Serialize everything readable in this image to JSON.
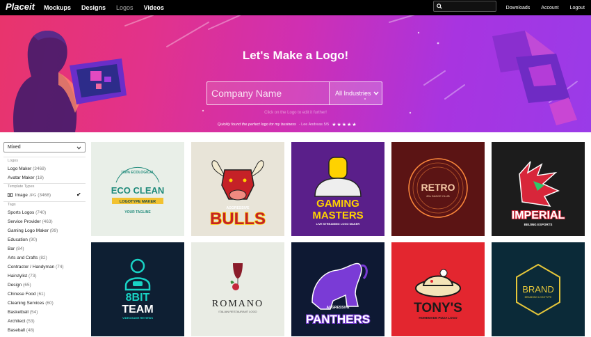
{
  "nav": {
    "brand": "Placeit",
    "links": [
      "Mockups",
      "Designs",
      "Logos",
      "Videos"
    ],
    "right": [
      "Downloads",
      "Account",
      "Logout"
    ],
    "search_placeholder": ""
  },
  "hero": {
    "title": "Let's Make a Logo!",
    "company_placeholder": "Company Name",
    "industry_selected": "All Industries",
    "hint": "Click on the Logo to edit it further!",
    "testimonial": "Quickly found the perfect logo for my business",
    "author": "- Lee Andreas 5/5",
    "stars": "★★★★★",
    "colors": {
      "start": "#e8346c",
      "mid": "#cf2fb3",
      "end": "#9a3be8"
    }
  },
  "sidebar": {
    "sort": "Mixed",
    "sections": {
      "logos": "Logos",
      "template_types": "Template Types",
      "tags": "Tags"
    },
    "logo_items": [
      {
        "label": "Logo Maker",
        "count": "(3468)"
      },
      {
        "label": "Avatar Maker",
        "count": "(18)"
      }
    ],
    "template_item": {
      "label": "Image",
      "format": "JPG",
      "count": "(3468)"
    },
    "tags": [
      {
        "label": "Sports Logos",
        "count": "(740)"
      },
      {
        "label": "Service Provider",
        "count": "(463)"
      },
      {
        "label": "Gaming Logo Maker",
        "count": "(99)"
      },
      {
        "label": "Education",
        "count": "(90)"
      },
      {
        "label": "Bar",
        "count": "(84)"
      },
      {
        "label": "Arts and Crafts",
        "count": "(82)"
      },
      {
        "label": "Contractor / Handyman",
        "count": "(74)"
      },
      {
        "label": "Hairstylist",
        "count": "(73)"
      },
      {
        "label": "Design",
        "count": "(65)"
      },
      {
        "label": "Chinese Food",
        "count": "(61)"
      },
      {
        "label": "Cleaning Services",
        "count": "(60)"
      },
      {
        "label": "Basketball",
        "count": "(54)"
      },
      {
        "label": "Architect",
        "count": "(53)"
      },
      {
        "label": "Baseball",
        "count": "(48)"
      }
    ]
  },
  "logos": [
    {
      "name": "eco-clean",
      "bg": "#e9efe8",
      "top": "100% ECOLOGICAL",
      "title": "ECO CLEAN",
      "sub": "LOGOTYPE MAKER",
      "tag": "YOUR TAGLINE",
      "accent": "#1f8a7a"
    },
    {
      "name": "bulls",
      "bg": "#e8e4d8",
      "top": "AGGRESSIVE",
      "title": "BULLS",
      "accent": "#c52127"
    },
    {
      "name": "gaming-masters",
      "bg": "#5a1f8a",
      "title": "GAMING",
      "title2": "MASTERS",
      "sub": "LIVE STREAMING LOGO MAKER",
      "accent": "#ffd200"
    },
    {
      "name": "retro",
      "bg": "#5b1414",
      "title": "RETRO",
      "sub": "80s DANCE CLUB",
      "accent": "#ff8a3c"
    },
    {
      "name": "imperial",
      "bg": "#1c1c1c",
      "title": "IMPERIAL",
      "sub": "BEIJING ESPORTS",
      "accent": "#d8263a"
    },
    {
      "name": "8bit-team",
      "bg": "#0e1f33",
      "title": "8BIT",
      "title2": "TEAM",
      "sub": "VIDEOGAME REVIEWS",
      "accent": "#19d3c5"
    },
    {
      "name": "romano",
      "bg": "#e9ece4",
      "title": "ROMANO",
      "sub": "ITALIAN RESTAURANT LOGO",
      "accent": "#8a1c2a"
    },
    {
      "name": "panthers",
      "bg": "#0e1933",
      "top": "AGGRESSIVE",
      "title": "PANTHERS",
      "accent": "#7a3bd6"
    },
    {
      "name": "tonys",
      "bg": "#e3262f",
      "title": "TONY'S",
      "sub": "HOMEMADE PIZZA LOGO",
      "accent": "#1a1a1a"
    },
    {
      "name": "brand",
      "bg": "#0b2a38",
      "title": "BRAND",
      "sub": "BRANDING LOGOTYPE",
      "accent": "#e6c73a"
    }
  ]
}
